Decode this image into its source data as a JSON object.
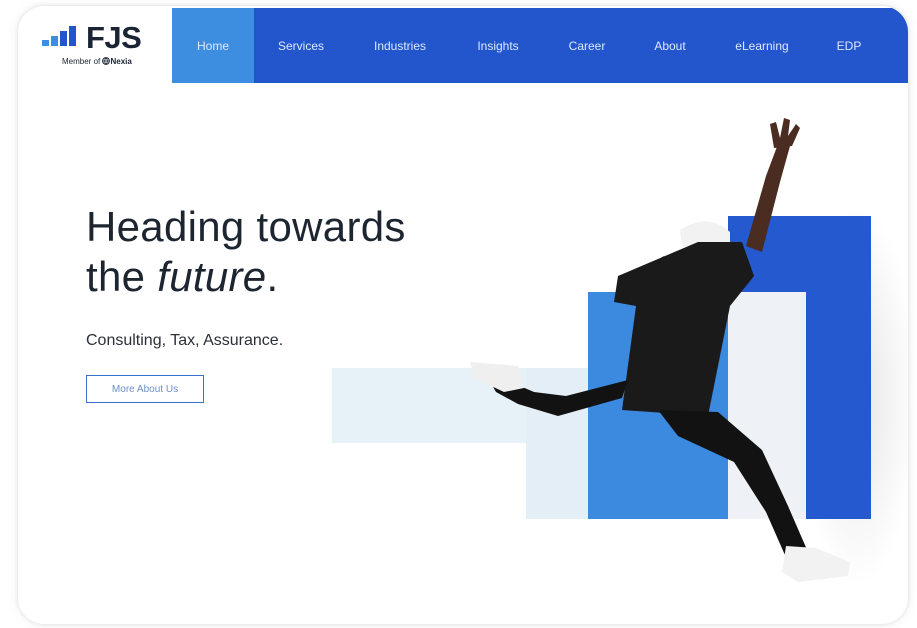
{
  "header": {
    "logo_text": "FJS",
    "logo_sub_prefix": "Member of",
    "logo_sub_brand": "Nexia"
  },
  "nav": {
    "items": [
      {
        "label": "Home",
        "active": true
      },
      {
        "label": "Services"
      },
      {
        "label": "Industries"
      },
      {
        "label": "Insights"
      },
      {
        "label": "Career"
      },
      {
        "label": "About"
      },
      {
        "label": "eLearning"
      },
      {
        "label": "EDP"
      }
    ]
  },
  "hero": {
    "title_line1": "Heading towards",
    "title_line2_prefix": "the ",
    "title_line2_em": "future",
    "title_line2_suffix": ".",
    "subtitle": "Consulting, Tax, Assurance.",
    "button_label": "More About Us"
  },
  "colors": {
    "nav_bg": "#2356cc",
    "nav_active": "#3d8de0",
    "bar_dark": "#2459cf",
    "bar_mid": "#3b8ae0",
    "bar_light": "#e6f0f8"
  },
  "icons": {
    "logo_mark": "bar-chart-icon",
    "nexia_mark": "globe-icon"
  }
}
